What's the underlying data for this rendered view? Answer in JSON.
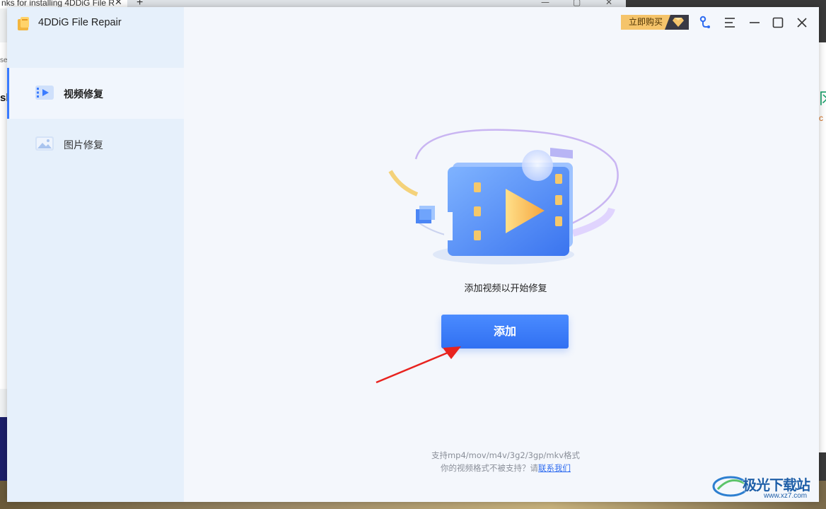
{
  "background": {
    "browser_tab_title": "nks for installing 4DDiG File R",
    "left_fragment_1": "se",
    "left_fragment_2": "sh",
    "right_fragment_1": "冈",
    "right_fragment_2": "c"
  },
  "app": {
    "title": "4DDiG File Repair",
    "buy_label": "立即购买"
  },
  "sidebar": {
    "items": [
      {
        "label": "视频修复",
        "active": true,
        "icon": "video-icon"
      },
      {
        "label": "图片修复",
        "active": false,
        "icon": "image-icon"
      }
    ]
  },
  "main": {
    "prompt": "添加视频以开始修复",
    "add_button": "添加",
    "support_line": "支持mp4/mov/m4v/3g2/3gp/mkv格式",
    "unsupported_prefix": "你的视频格式不被支持？请",
    "contact_link": "联系我们"
  },
  "watermark": {
    "text": "极光下载站",
    "url": "www.xz7.com"
  },
  "colors": {
    "accent": "#3a7bff",
    "button": "#3170f2",
    "sidebar_bg": "#e6f0fb",
    "main_bg": "#f4f7fc",
    "buy_bg": "#f5c46b"
  }
}
